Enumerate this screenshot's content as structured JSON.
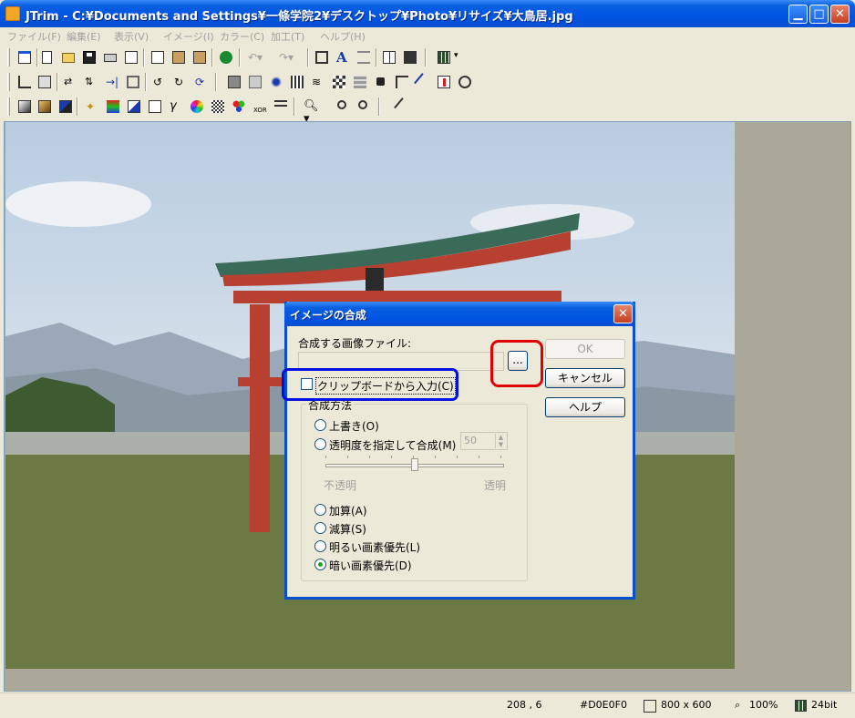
{
  "window": {
    "title": "JTrim - C:¥Documents and Settings¥一條学院2¥デスクトップ¥Photo¥リサイズ¥大鳥居.jpg",
    "min_glyph": "▁",
    "max_glyph": "□",
    "close_glyph": "✕"
  },
  "menu": [
    "ファイル(F)",
    "編集(E)",
    "表示(V)",
    "イメージ(I)",
    "カラー(C)",
    "加工(T)",
    "ヘルプ(H)"
  ],
  "dialog": {
    "title": "イメージの合成",
    "close_glyph": "✕",
    "file_label": "合成する画像ファイル:",
    "file_value": "",
    "browse_label": "...",
    "ok_label": "OK",
    "cancel_label": "キャンセル",
    "help_label": "ヘルプ",
    "clipboard_label": "クリップボードから入力(C)",
    "clipboard_checked": false,
    "method_group_label": "合成方法",
    "overwrite_label": "上書き(O)",
    "transparency_label": "透明度を指定して合成(M)",
    "transparency_value": "50",
    "slider_min_label": "不透明",
    "slider_max_label": "透明",
    "add_label": "加算(A)",
    "subtract_label": "減算(S)",
    "lighter_label": "明るい画素優先(L)",
    "darker_label": "暗い画素優先(D)",
    "selected_method": "darker"
  },
  "status": {
    "coords": "208 , 6",
    "color": "#D0E0F0",
    "size": "800 x 600",
    "zoom": "100%",
    "depth": "24bit"
  },
  "colors": {
    "title_blue": "#0054e3",
    "highlight_red": "#e00000",
    "highlight_blue": "#0010e0"
  }
}
